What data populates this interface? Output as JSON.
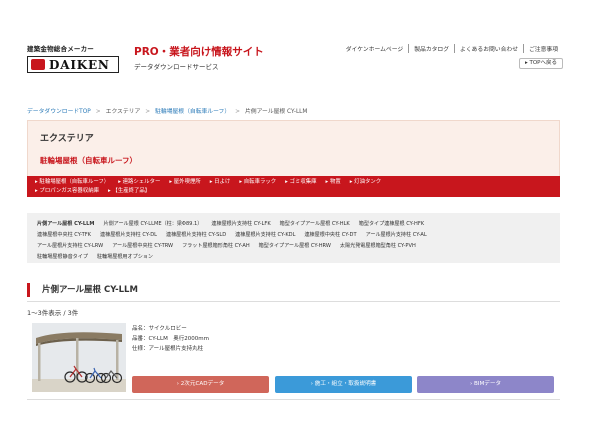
{
  "header": {
    "logo_tagline": "建築金物総合メーカー",
    "logo_text": "DAIKEN",
    "site_title": "PRO・業者向け情報サイト",
    "site_subtitle": "データダウンロードサービス",
    "top_links": [
      "ダイケンホームページ",
      "製品カタログ",
      "よくあるお問い合わせ",
      "ご注意事項"
    ],
    "top_back": "▸ TOPへ戻る"
  },
  "breadcrumb": {
    "items": [
      "データダウンロードTOP",
      "エクステリア",
      "駐輪場屋根（自転車ルーフ）",
      "片側アール屋根 CY-LLM"
    ],
    "separator": ">"
  },
  "category": {
    "title": "エクステリア",
    "subtitle": "駐輪場屋根（自転車ルーフ）",
    "nav_row1": [
      "駐輪場屋根（自転車ルーフ）",
      "連路シェルター",
      "屋外喫煙所",
      "日よけ",
      "自転車ラック",
      "ゴミ収集庫",
      "物置",
      "灯油タンク"
    ],
    "nav_row2": [
      "プロパンガス容器収納庫",
      "【生産終了品】"
    ]
  },
  "products": {
    "row1": [
      "片側アール屋根 CY-LLM",
      "片側アール屋根 CY-LLME（柱：梁Φ89.1）",
      "連棟屋根片支持柱 CY-LFK",
      "箱型タイプアール屋根 CY-HLK",
      "箱型タイプ連棟屋根 CY-HFK"
    ],
    "row2": [
      "連棟屋根中央柱 CY-TFK",
      "連棟屋根片支持柱 CY-DL",
      "連棟屋根片支持柱 CY-SLD",
      "連棟屋根片支持柱 CY-KDL",
      "連棟屋根中央柱 CY-DT",
      "アール屋根片支持柱 CY-AL"
    ],
    "row3": [
      "アール屋根片支持柱 CY-LRW",
      "アール屋根中央柱 CY-TRW",
      "フラット屋根箱形角柱 CY-AH",
      "箱型タイプアール屋根 CY-HRW",
      "太陽光発電屋根箱型角柱 CY-PVH"
    ],
    "row4": [
      "駐輪場屋根静音タイプ",
      "駐輪場屋根用オプション"
    ],
    "active_index": 0
  },
  "section": {
    "title": "片側アール屋根 CY-LLM",
    "count": "1〜3件表示 / 3件"
  },
  "product": {
    "name": "品名：サイクルロビー",
    "model": "品番：CY-LLM　奥行2000mm",
    "spec": "仕様：アール屋根片支持丸柱"
  },
  "buttons": {
    "cad": "2次元CADデータ",
    "manual": "施工・組立・取扱説明書",
    "bim": "BIMデータ"
  },
  "colors": {
    "brand_red": "#c8161d",
    "cad_button": "#d0665a",
    "manual_button": "#3b9ad9",
    "bim_button": "#8d86c9"
  }
}
